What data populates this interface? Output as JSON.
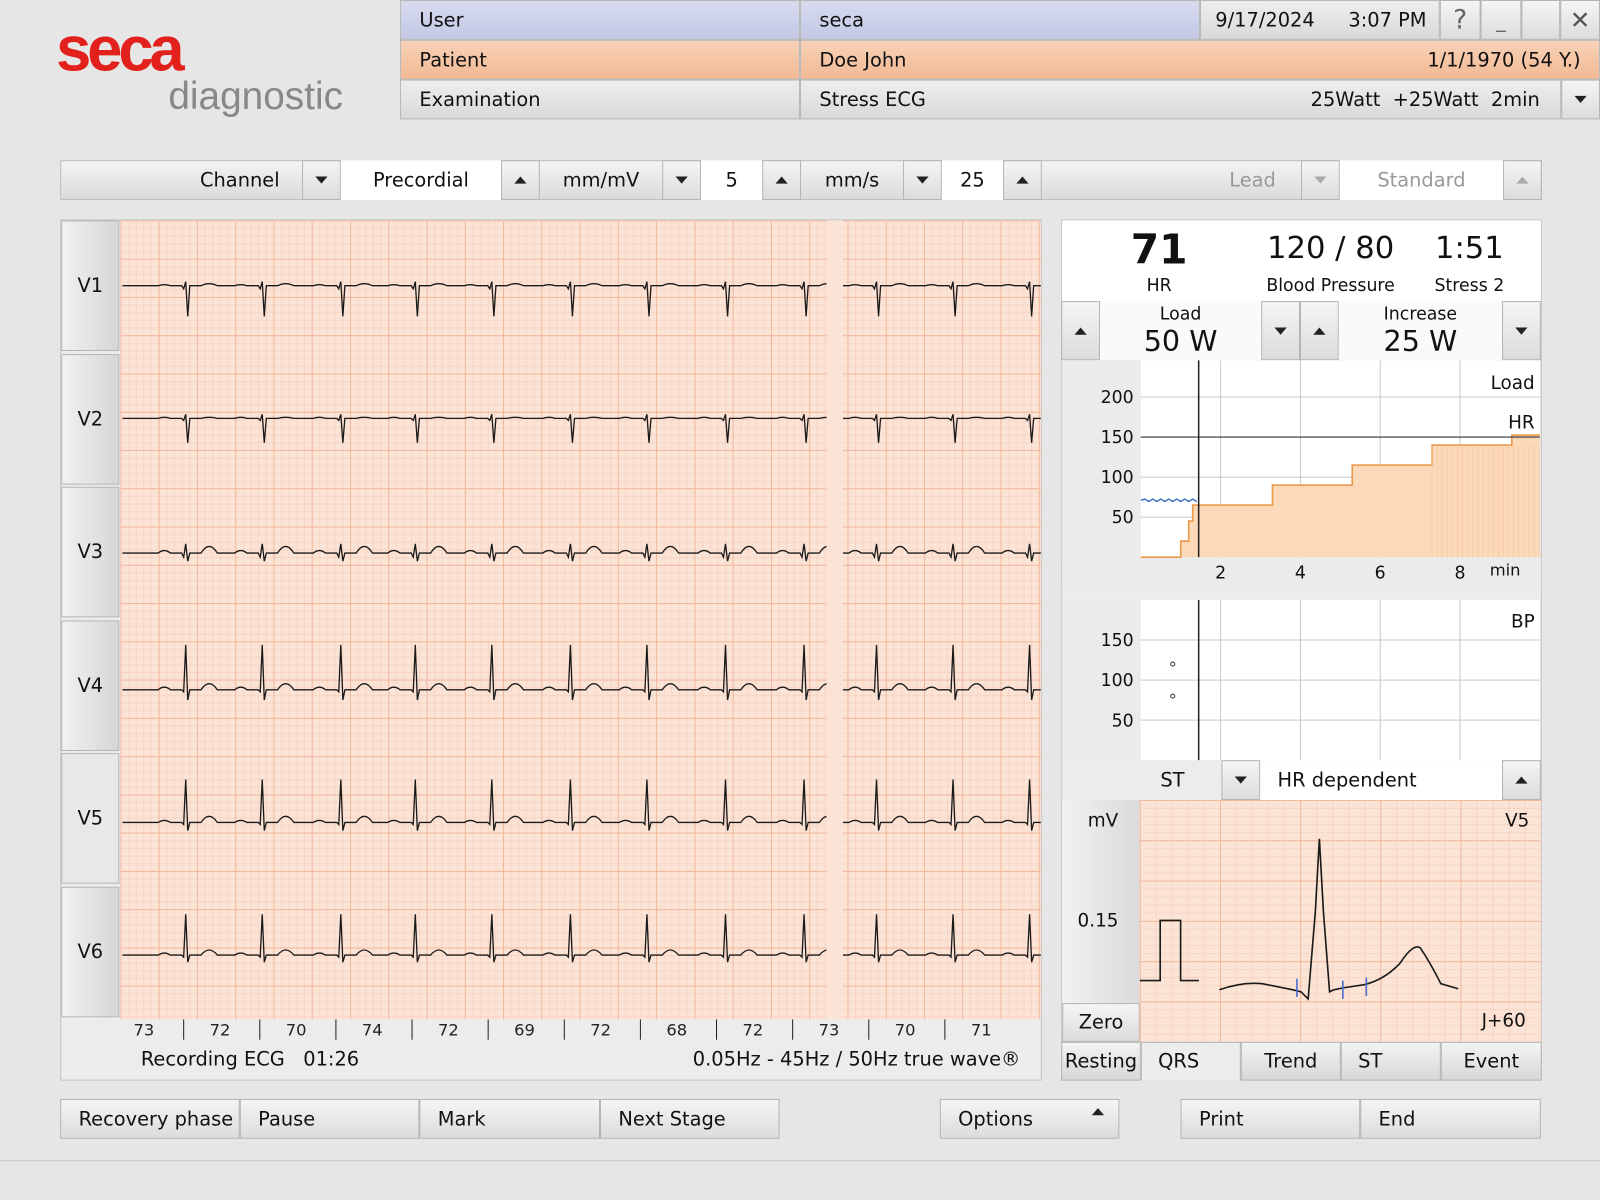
{
  "brand": {
    "name": "seca",
    "sub": "diagnostic"
  },
  "header": {
    "user_label": "User",
    "user_value": "seca",
    "date": "9/17/2024",
    "time": "3:07 PM",
    "help_symbol": "?",
    "minimize_symbol": "_",
    "close_symbol": "✕",
    "patient_label": "Patient",
    "patient_name": "Doe John",
    "patient_dob": "1/1/1970 (54 Y.)",
    "exam_label": "Examination",
    "exam_value": "Stress ECG",
    "protocol": "25Watt  +25Watt  2min"
  },
  "toolbar": {
    "channel_label": "Channel",
    "channel_value": "Precordial",
    "gain_unit": "mm/mV",
    "gain_value": "5",
    "speed_unit": "mm/s",
    "speed_value": "25",
    "lead_label": "Lead",
    "lead_value": "Standard"
  },
  "leads": [
    "V1",
    "V2",
    "V3",
    "V4",
    "V5",
    "V6"
  ],
  "beat_hr": [
    "73",
    "72",
    "70",
    "74",
    "72",
    "69",
    "72",
    "68",
    "72",
    "73",
    "70",
    "71"
  ],
  "status": {
    "recording": "Recording ECG",
    "elapsed": "01:26",
    "filter": "0.05Hz - 45Hz / 50Hz true wave®"
  },
  "vitals": {
    "hr_value": "71",
    "hr_label": "HR",
    "bp_value": "120 / 80",
    "bp_label": "Blood Pressure",
    "stage_time": "1:51",
    "stage_label": "Stress 2"
  },
  "load": {
    "load_label": "Load",
    "load_value": "50 W",
    "increase_label": "Increase",
    "increase_value": "25 W"
  },
  "trend_chart": {
    "y_ticks": [
      "200",
      "150",
      "100",
      "50"
    ],
    "x_ticks": [
      "2",
      "4",
      "6",
      "8"
    ],
    "x_unit": "min",
    "legend_load": "Load",
    "legend_hr": "HR",
    "hr_line": 150,
    "current_min": 1.45,
    "load_steps": [
      [
        0,
        0
      ],
      [
        1,
        0
      ],
      [
        1,
        0.8
      ],
      [
        1.2,
        0.8
      ],
      [
        1.2,
        1.8
      ],
      [
        1.3,
        1.8
      ],
      [
        1.3,
        2.6
      ],
      [
        3.3,
        2.6
      ],
      [
        3.3,
        3.6
      ],
      [
        5.3,
        3.6
      ],
      [
        5.3,
        4.6
      ],
      [
        7.3,
        4.6
      ],
      [
        7.3,
        5.6
      ],
      [
        9.3,
        5.6
      ],
      [
        9.3,
        6.1
      ],
      [
        10,
        6.1
      ]
    ]
  },
  "bp_chart": {
    "y_ticks": [
      "150",
      "100",
      "50"
    ],
    "legend": "BP",
    "points": [
      {
        "x": 0.8,
        "y": 120
      },
      {
        "x": 0.8,
        "y": 80
      }
    ]
  },
  "st_panel": {
    "mode_label": "ST",
    "mode_value": "HR dependent",
    "unit": "mV",
    "scale": "0.15",
    "lead": "V5",
    "measure_point": "J+60",
    "zero_label": "Zero"
  },
  "tabs": [
    "Resting",
    "QRS",
    "Trend",
    "ST",
    "Event"
  ],
  "bottom_buttons": {
    "recovery": "Recovery phase",
    "pause": "Pause",
    "mark": "Mark",
    "next_stage": "Next Stage",
    "options": "Options",
    "print": "Print",
    "end": "End"
  },
  "colors": {
    "seca_red": "#e2211c",
    "ecg_paper": "#fbe3d6",
    "load_fill": "#fbd9b9",
    "load_line": "#eb9a4c",
    "hr_trace": "#2a67c8"
  }
}
